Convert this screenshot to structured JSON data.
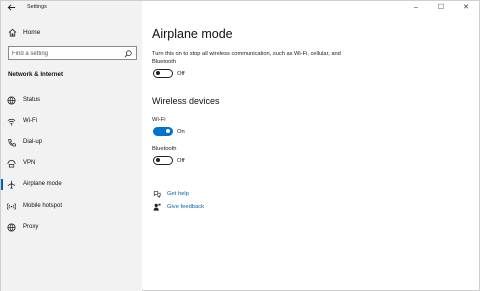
{
  "window": {
    "app_title": "Settings",
    "controls": {
      "minimize": "–",
      "maximize": "☐",
      "close": "✕"
    }
  },
  "sidebar": {
    "home_label": "Home",
    "search": {
      "placeholder": "Find a setting"
    },
    "section_title": "Network & Internet",
    "items": [
      {
        "label": "Status",
        "icon": "globe-icon"
      },
      {
        "label": "Wi-Fi",
        "icon": "wifi-icon"
      },
      {
        "label": "Dial-up",
        "icon": "dialup-icon"
      },
      {
        "label": "VPN",
        "icon": "vpn-icon"
      },
      {
        "label": "Airplane mode",
        "icon": "airplane-icon",
        "active": true
      },
      {
        "label": "Mobile hotspot",
        "icon": "hotspot-icon"
      },
      {
        "label": "Proxy",
        "icon": "globe-icon"
      }
    ]
  },
  "main": {
    "title": "Airplane mode",
    "description": "Turn this on to stop all wireless communication, such as Wi-Fi, cellular, and Bluetooth",
    "airplane_toggle": {
      "state": "Off",
      "on": false
    },
    "wireless_title": "Wireless devices",
    "wifi": {
      "label": "Wi-Fi",
      "state": "On",
      "on": true
    },
    "bluetooth": {
      "label": "Bluetooth",
      "state": "Off",
      "on": false
    },
    "links": [
      {
        "label": "Get help",
        "icon": "help-icon"
      },
      {
        "label": "Give feedback",
        "icon": "feedback-icon"
      }
    ]
  },
  "colors": {
    "accent": "#0063b1",
    "toggle_on": "#0073cf",
    "sidebar_bg": "#f2f2f2"
  }
}
